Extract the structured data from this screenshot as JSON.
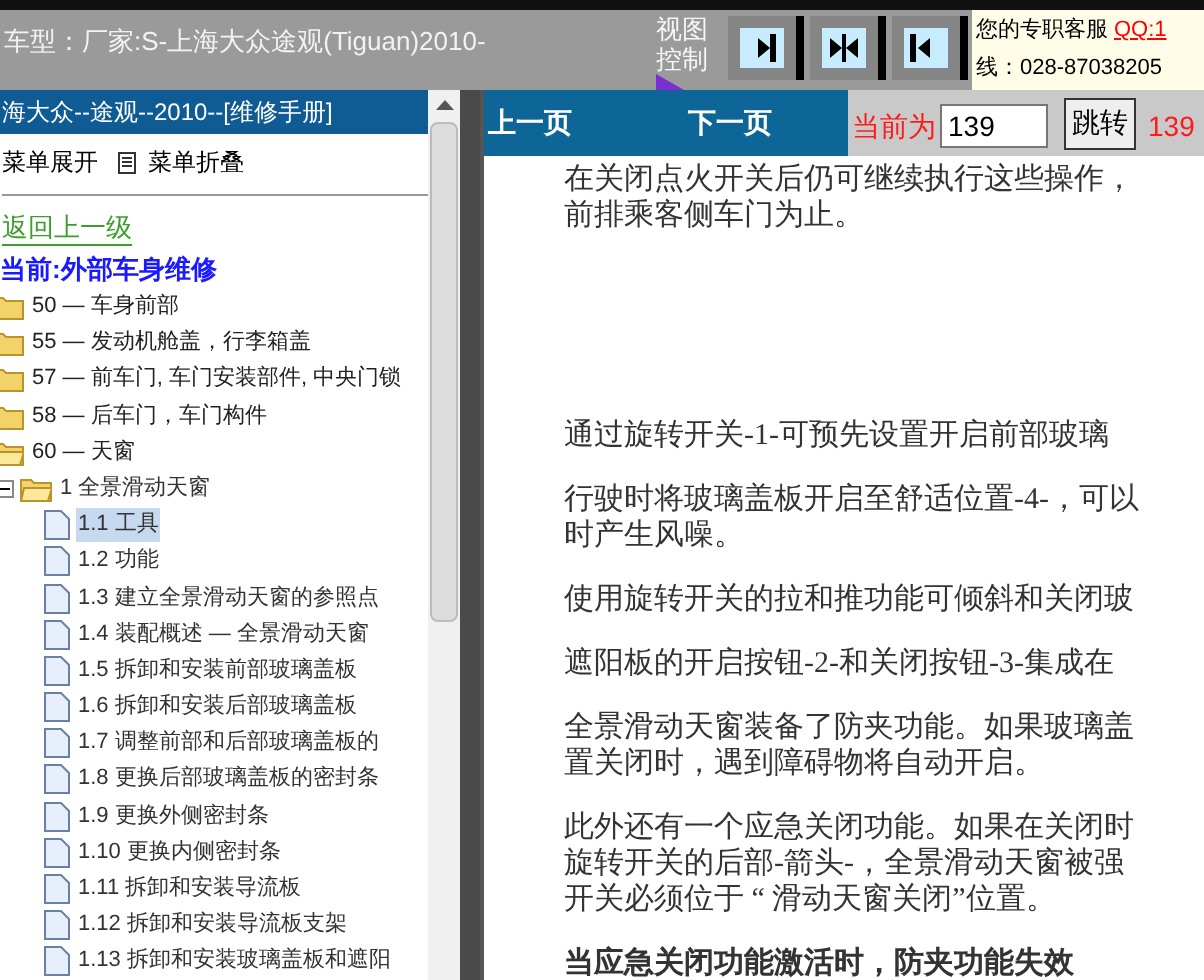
{
  "header": {
    "model": "车型：厂家:S-上海大众途观(Tiguan)2010-",
    "view_label": "视图控制",
    "view_buttons": [
      {
        "kind": "right"
      },
      {
        "kind": "center"
      },
      {
        "kind": "left"
      }
    ],
    "service": {
      "label": "您的专职客服",
      "qq": "QQ:1",
      "phone": "线：028-87038205"
    }
  },
  "sidebar": {
    "title": "海大众--途观--2010--[维修手册]",
    "expand": "菜单展开",
    "collapse": "菜单折叠",
    "back": "返回上一级",
    "current": "当前:外部车身维修",
    "tree": [
      {
        "label": "50 — 车身前部",
        "expanded": false
      },
      {
        "label": "55 — 发动机舱盖，行李箱盖",
        "expanded": false
      },
      {
        "label": "57 — 前车门, 车门安装部件, 中央门锁",
        "expanded": false
      },
      {
        "label": "58 — 后车门，车门构件",
        "expanded": false
      },
      {
        "label": "60 — 天窗",
        "expanded": true,
        "children": [
          {
            "label": "1 全景滑动天窗",
            "expanded": true,
            "children": [
              {
                "label": "1.1 工具",
                "selected": true
              },
              {
                "label": "1.2 功能",
                "selected": false
              },
              {
                "label": "1.3 建立全景滑动天窗的参照点",
                "selected": false
              },
              {
                "label": "1.4 装配概述 — 全景滑动天窗",
                "selected": false
              },
              {
                "label": "1.5 拆卸和安装前部玻璃盖板",
                "selected": false
              },
              {
                "label": "1.6 拆卸和安装后部玻璃盖板",
                "selected": false
              },
              {
                "label": "1.7 调整前部和后部玻璃盖板的",
                "selected": false
              },
              {
                "label": "1.8 更换后部玻璃盖板的密封条",
                "selected": false
              },
              {
                "label": "1.9 更换外侧密封条",
                "selected": false
              },
              {
                "label": "1.10 更换内侧密封条",
                "selected": false
              },
              {
                "label": "1.11 拆卸和安装导流板",
                "selected": false
              },
              {
                "label": "1.12 拆卸和安装导流板支架",
                "selected": false
              },
              {
                "label": "1.13 拆卸和安装玻璃盖板和遮阳",
                "selected": false
              }
            ]
          }
        ]
      }
    ]
  },
  "toolbar": {
    "prev": "上一页",
    "next": "下一页",
    "current_label": "当前为",
    "page_input": "139",
    "go": "跳转",
    "total": "139"
  },
  "content": [
    {
      "bold": false,
      "lines": [
        "在关闭点火开关后仍可继续执行这些操作，",
        "前排乘客侧车门为止。"
      ]
    },
    {
      "bold": false,
      "gap": true,
      "lines": [
        "通过旋转开关-1-可预先设置开启前部玻璃"
      ]
    },
    {
      "bold": false,
      "lines": [
        "行驶时将玻璃盖板开启至舒适位置-4-，可以",
        "时产生风噪。"
      ]
    },
    {
      "bold": false,
      "lines": [
        "使用旋转开关的拉和推功能可倾斜和关闭玻"
      ]
    },
    {
      "bold": false,
      "lines": [
        "遮阳板的开启按钮-2-和关闭按钮-3-集成在"
      ]
    },
    {
      "bold": false,
      "lines": [
        "全景滑动天窗装备了防夹功能。如果玻璃盖",
        "置关闭时，遇到障碍物将自动开启。"
      ]
    },
    {
      "bold": false,
      "lines": [
        "此外还有一个应急关闭功能。如果在关闭时",
        "旋转开关的后部-箭头-，全景滑动天窗被强",
        "开关必须位于 “ 滑动天窗关闭”位置。"
      ]
    },
    {
      "bold": true,
      "lines": [
        "当应急关闭功能激活时，防夹功能失效"
      ]
    }
  ]
}
